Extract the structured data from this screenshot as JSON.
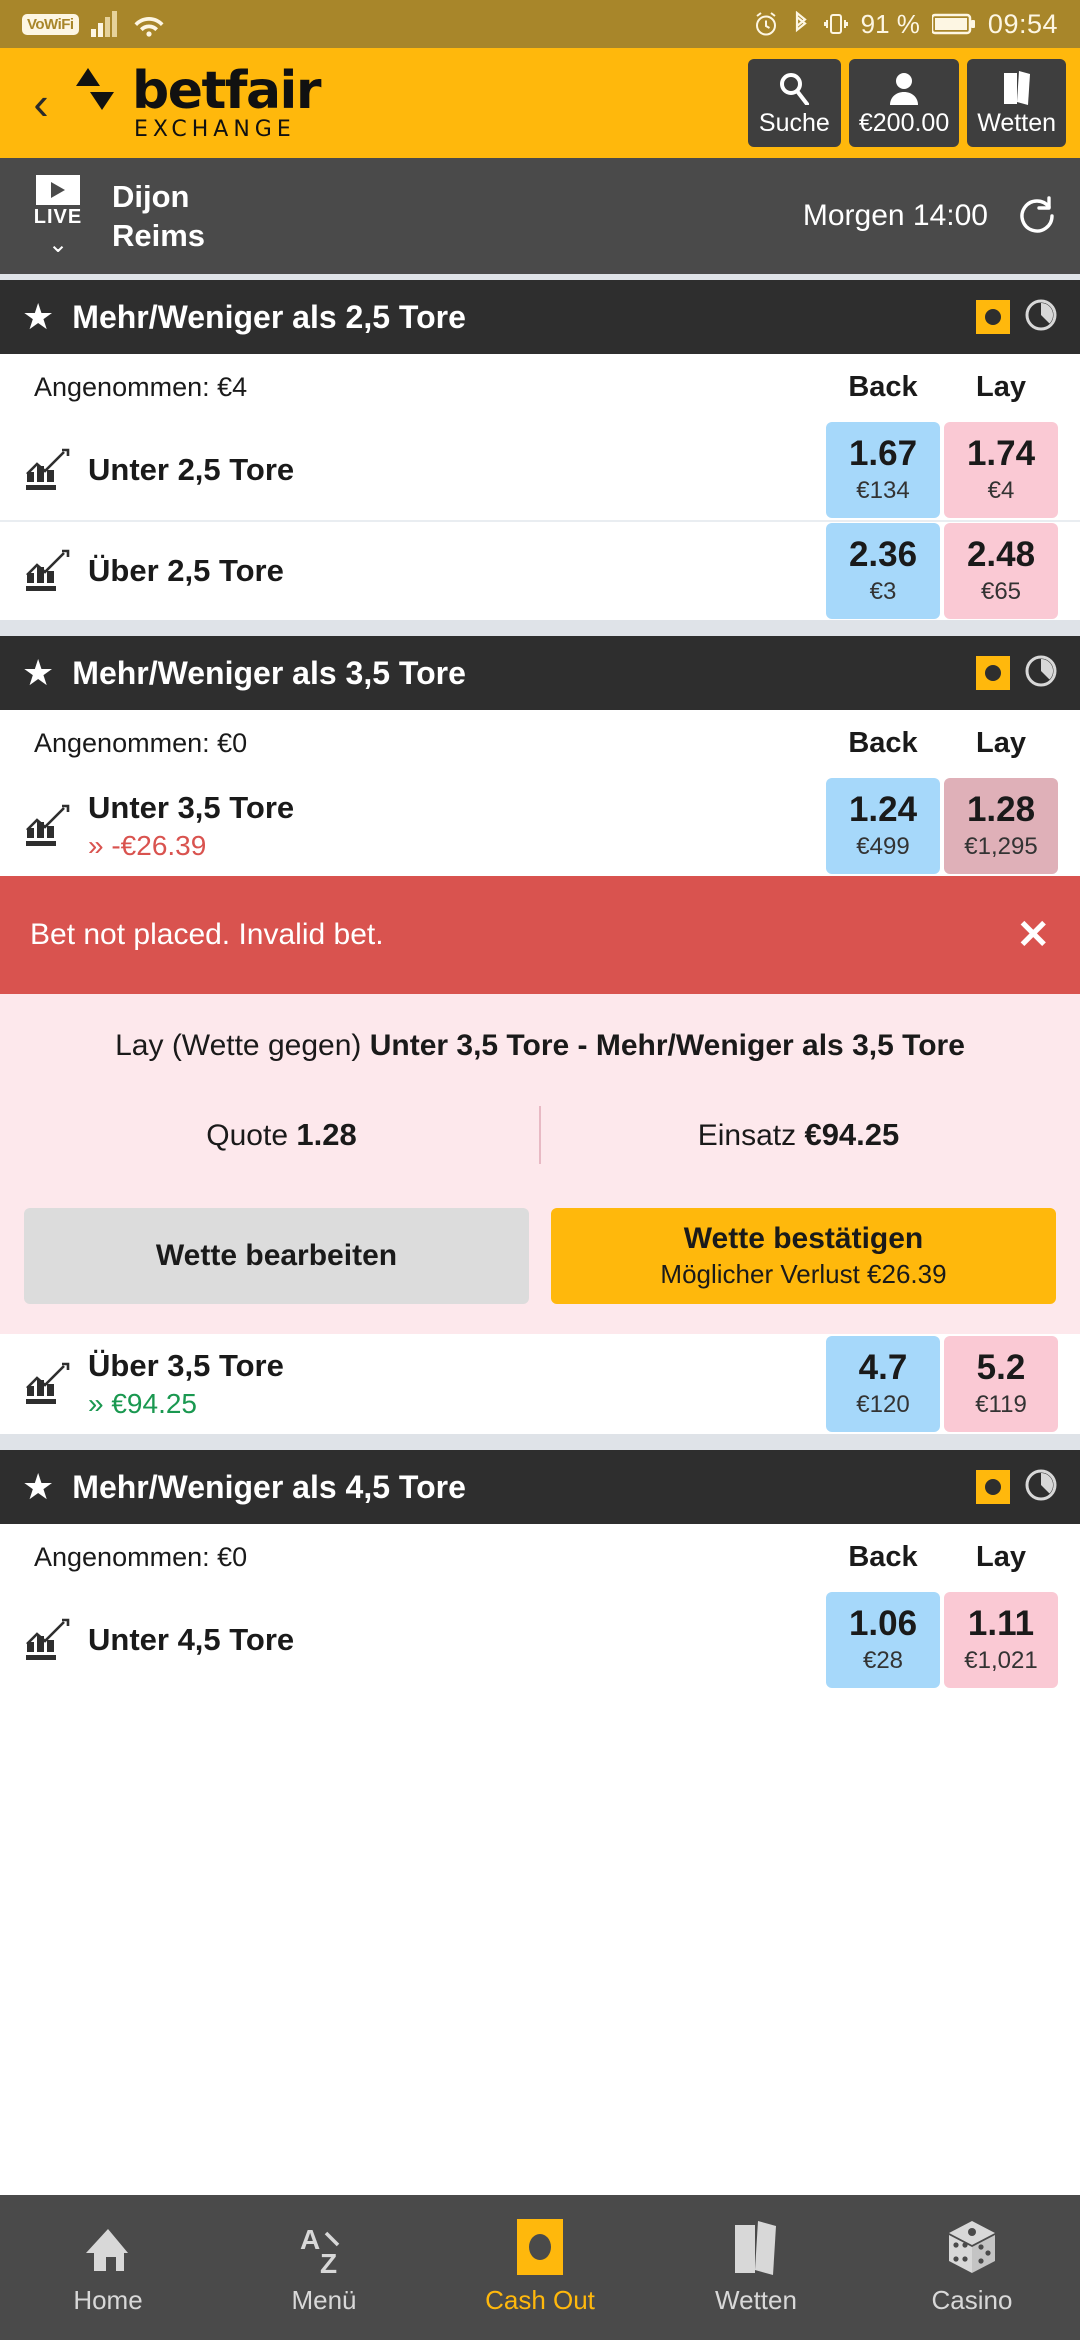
{
  "status_bar": {
    "vowifi_label": "VoWiFi",
    "signal_icon": "cellular-signal-icon",
    "wifi_icon": "wifi-icon",
    "alarm_icon": "alarm-clock-icon",
    "bluetooth_icon": "bluetooth-icon",
    "vibrate_icon": "vibrate-icon",
    "battery_percent": "91 %",
    "battery_icon": "battery-icon",
    "time": "09:54"
  },
  "brand_bar": {
    "back_icon": "chevron-left-icon",
    "logo_word": "betfair",
    "logo_sub": "EXCHANGE",
    "actions": [
      {
        "icon": "search-icon",
        "label": "Suche"
      },
      {
        "icon": "account-icon",
        "label": "€200.00"
      },
      {
        "icon": "bets-icon",
        "label": "Wetten"
      }
    ]
  },
  "event_bar": {
    "live_label": "LIVE",
    "play_icon": "play-icon",
    "expand_icon": "chevron-down-icon",
    "team_home": "Dijon",
    "team_away": "Reims",
    "kickoff": "Morgen 14:00",
    "refresh_icon": "refresh-icon"
  },
  "column_headers": {
    "back": "Back",
    "lay": "Lay"
  },
  "markets": [
    {
      "title": "Mehr/Weniger als 2,5 Tore",
      "star_icon": "star-icon",
      "cashout_icon": "cashout-icon",
      "timer_icon": "pie-timer-icon",
      "matched_label": "Angenommen: €4",
      "selections": [
        {
          "name": "Unter 2,5 Tore",
          "chart_icon": "price-chart-icon",
          "pl": "",
          "pl_state": "none",
          "back": {
            "odds": "1.67",
            "amount": "€134"
          },
          "lay": {
            "odds": "1.74",
            "amount": "€4",
            "selected": false
          }
        },
        {
          "name": "Über 2,5 Tore",
          "chart_icon": "price-chart-icon",
          "pl": "",
          "pl_state": "none",
          "back": {
            "odds": "2.36",
            "amount": "€3"
          },
          "lay": {
            "odds": "2.48",
            "amount": "€65",
            "selected": false
          }
        }
      ]
    },
    {
      "title": "Mehr/Weniger als 3,5 Tore",
      "star_icon": "star-icon",
      "cashout_icon": "cashout-icon",
      "timer_icon": "pie-timer-icon",
      "matched_label": "Angenommen: €0",
      "selections": [
        {
          "name": "Unter 3,5 Tore",
          "chart_icon": "price-chart-icon",
          "pl": "» -€26.39",
          "pl_state": "negative",
          "back": {
            "odds": "1.24",
            "amount": "€499"
          },
          "lay": {
            "odds": "1.28",
            "amount": "€1,295",
            "selected": true
          }
        }
      ],
      "selections_after": [
        {
          "name": "Über 3,5 Tore",
          "chart_icon": "price-chart-icon",
          "pl": "» €94.25",
          "pl_state": "positive",
          "back": {
            "odds": "4.7",
            "amount": "€120"
          },
          "lay": {
            "odds": "5.2",
            "amount": "€119",
            "selected": false
          }
        }
      ]
    },
    {
      "title": "Mehr/Weniger als 4,5 Tore",
      "star_icon": "star-icon",
      "cashout_icon": "cashout-icon",
      "timer_icon": "pie-timer-icon",
      "matched_label": "Angenommen: €0",
      "selections": [
        {
          "name": "Unter 4,5 Tore",
          "chart_icon": "price-chart-icon",
          "pl": "",
          "pl_state": "none",
          "back": {
            "odds": "1.06",
            "amount": "€28"
          },
          "lay": {
            "odds": "1.11",
            "amount": "€1,021",
            "selected": false
          }
        }
      ]
    }
  ],
  "error_banner": {
    "message": "Bet not placed. Invalid bet.",
    "close_icon": "close-icon",
    "color": "#d9534f"
  },
  "bet_slip": {
    "type_label": "Lay (Wette gegen)",
    "selection_label": "Unter 3,5 Tore - Mehr/Weniger als 3,5 Tore",
    "odds_label": "Quote",
    "odds_value": "1.28",
    "stake_label": "Einsatz",
    "stake_value": "€94.25",
    "edit_button": "Wette bearbeiten",
    "confirm_button": "Wette bestätigen",
    "confirm_sub": "Möglicher Verlust €26.39",
    "background": "#fde8ec",
    "confirm_color": "#ffb80c"
  },
  "bottom_nav": [
    {
      "icon": "home-icon",
      "label": "Home",
      "active": false
    },
    {
      "icon": "az-menu-icon",
      "label": "Menü",
      "active": false
    },
    {
      "icon": "cashout-icon",
      "label": "Cash Out",
      "active": true
    },
    {
      "icon": "bets-icon",
      "label": "Wetten",
      "active": false
    },
    {
      "icon": "dice-icon",
      "label": "Casino",
      "active": false
    }
  ],
  "theme": {
    "brand_yellow": "#ffb80c",
    "back_blue": "#a6d8fa",
    "lay_pink": "#fac9d4",
    "dark": "#2e2e2e"
  }
}
